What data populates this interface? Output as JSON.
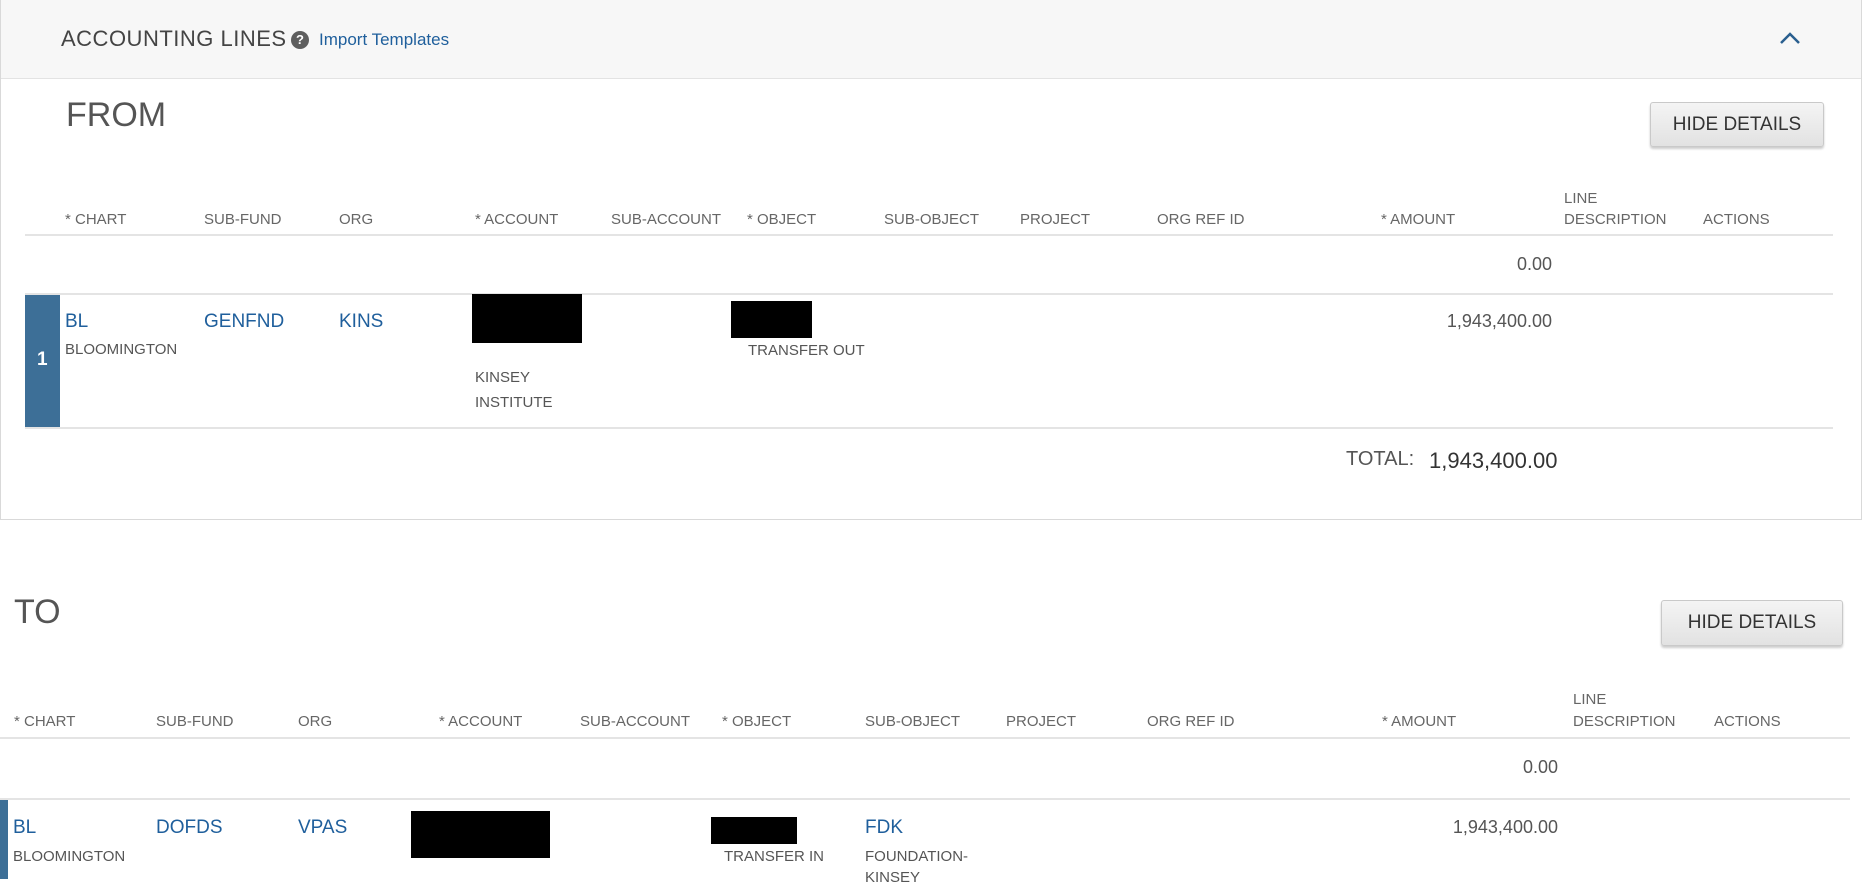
{
  "panel": {
    "title": "ACCOUNTING LINES",
    "help_icon": "?",
    "import_link": "Import Templates"
  },
  "from": {
    "title": "FROM",
    "hide_details": "HIDE DETAILS",
    "headers": {
      "chart": "* CHART",
      "sub_fund": "SUB-FUND",
      "org": "ORG",
      "account": "* ACCOUNT",
      "sub_account": "SUB-ACCOUNT",
      "object": "* OBJECT",
      "sub_object": "SUB-OBJECT",
      "project": "PROJECT",
      "org_ref_id": "ORG REF ID",
      "amount": "* AMOUNT",
      "line_desc_1": "LINE",
      "line_desc_2": "DESCRIPTION",
      "actions": "ACTIONS"
    },
    "new_line_amount": "0.00",
    "row": {
      "number": "1",
      "chart": "BL",
      "chart_name": "BLOOMINGTON",
      "sub_fund": "GENFND",
      "org": "KINS",
      "account_name_1": "KINSEY",
      "account_name_2": "INSTITUTE",
      "object_name": "TRANSFER OUT",
      "amount": "1,943,400.00"
    },
    "total_label": "TOTAL:",
    "total_value": "1,943,400.00"
  },
  "to": {
    "title": "TO",
    "hide_details": "HIDE DETAILS",
    "headers": {
      "chart": "* CHART",
      "sub_fund": "SUB-FUND",
      "org": "ORG",
      "account": "* ACCOUNT",
      "sub_account": "SUB-ACCOUNT",
      "object": "* OBJECT",
      "sub_object": "SUB-OBJECT",
      "project": "PROJECT",
      "org_ref_id": "ORG REF ID",
      "amount": "* AMOUNT",
      "line_desc_1": "LINE",
      "line_desc_2": "DESCRIPTION",
      "actions": "ACTIONS"
    },
    "new_line_amount": "0.00",
    "row": {
      "chart": "BL",
      "chart_name": "BLOOMINGTON",
      "sub_fund": "DOFDS",
      "org": "VPAS",
      "object_name": "TRANSFER IN",
      "sub_object": "FDK",
      "sub_object_name_1": "FOUNDATION-",
      "sub_object_name_2": "KINSEY",
      "amount": "1,943,400.00"
    }
  }
}
